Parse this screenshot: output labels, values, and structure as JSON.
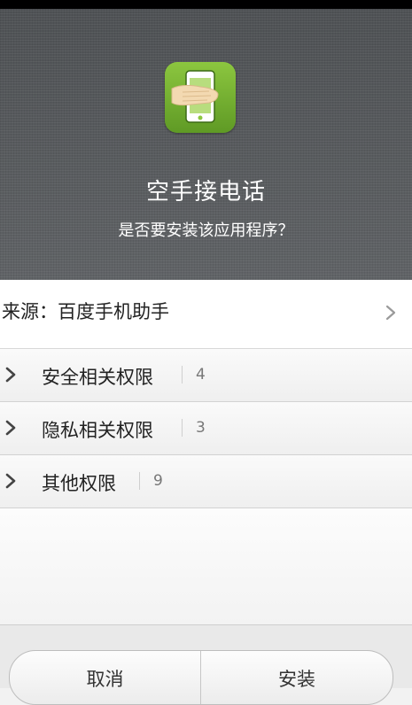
{
  "app": {
    "name": "空手接电话",
    "prompt": "是否要安装该应用程序？",
    "icon": "hand-phone-icon"
  },
  "source": {
    "label": "来源：百度手机助手"
  },
  "permissions": [
    {
      "label": "安全相关权限",
      "count": "4"
    },
    {
      "label": "隐私相关权限",
      "count": "3"
    },
    {
      "label": "其他权限",
      "count": "9"
    }
  ],
  "buttons": {
    "cancel": "取消",
    "install": "安装"
  },
  "colors": {
    "icon_green": "#7ab93a",
    "header_gray": "#5a5d60"
  }
}
